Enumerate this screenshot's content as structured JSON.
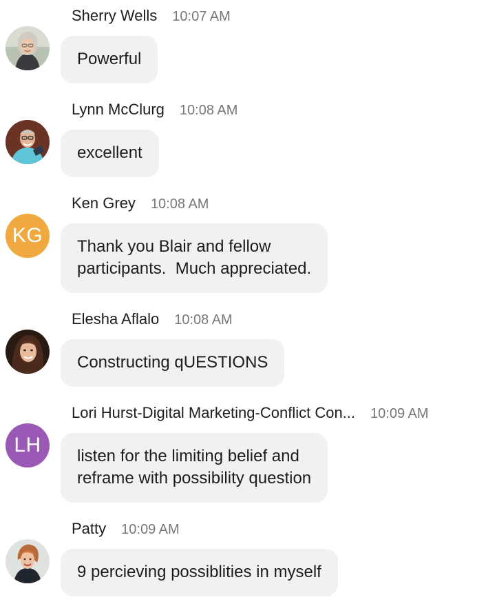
{
  "colors": {
    "bubble_bg": "#f1f1f3",
    "name_text": "#1d1d1f",
    "time_text": "#77777b",
    "avatar_kg": "#f0a93f",
    "avatar_lh": "#9b59b6"
  },
  "messages": [
    {
      "sender": "Sherry Wells",
      "time": "10:07 AM",
      "avatar": "photo",
      "lines": [
        "Powerful"
      ]
    },
    {
      "sender": "Lynn McClurg",
      "time": "10:08 AM",
      "avatar": "photo",
      "lines": [
        "excellent"
      ]
    },
    {
      "sender": "Ken Grey",
      "time": "10:08 AM",
      "avatar_initials": "KG",
      "lines": [
        "Thank you Blair and fellow",
        "participants.  Much appreciated."
      ]
    },
    {
      "sender": "Elesha Aflalo",
      "time": "10:08 AM",
      "avatar": "photo",
      "lines": [
        "Constructing qUESTIONS"
      ]
    },
    {
      "sender": "Lori Hurst-Digital Marketing-Conflict Con...",
      "time": "10:09 AM",
      "avatar_initials": "LH",
      "lines": [
        "listen for the limiting belief and",
        "reframe with possibility question"
      ]
    },
    {
      "sender": "Patty",
      "time": "10:09 AM",
      "avatar": "photo",
      "lines": [
        "9 percieving possiblities in myself"
      ]
    }
  ]
}
